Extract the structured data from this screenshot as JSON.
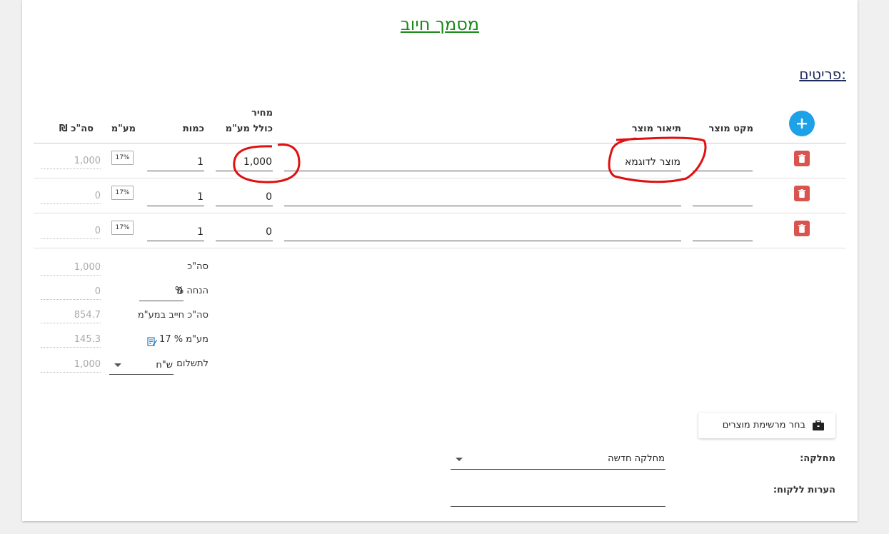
{
  "document_title": "מסמך חיוב",
  "section_title": "פריטים:",
  "columns": {
    "sku": "מקט מוצר",
    "description": "תיאור מוצר",
    "price_line1": "מחיר",
    "price_line2": "כולל מע\"מ",
    "quantity": "כמות",
    "vat": "מע\"מ",
    "total": "סה\"כ ₪"
  },
  "rows": [
    {
      "sku": "",
      "description": "מוצר לדוגמא",
      "price": "1,000",
      "quantity": "1",
      "vat": "17%",
      "total": "1,000"
    },
    {
      "sku": "",
      "description": "",
      "price": "0",
      "quantity": "1",
      "vat": "17%",
      "total": "0"
    },
    {
      "sku": "",
      "description": "",
      "price": "0",
      "quantity": "1",
      "vat": "17%",
      "total": "0"
    }
  ],
  "summary": {
    "subtotal_label": "סה\"כ",
    "subtotal_value": "1,000",
    "discount_label": "הנחה %",
    "discount_input": "0",
    "discount_value": "0",
    "taxable_label": "סה\"כ חייב במע\"מ",
    "taxable_value": "854.7",
    "vat_label": "מע\"מ % 17",
    "vat_value": "145.3",
    "payment_label": "לתשלום",
    "currency": "ש\"ח",
    "payment_value": "1,000"
  },
  "choose_products_button": "בחר מרשימת מוצרים",
  "department_label": "מחלקה:",
  "department_value": "מחלקה חדשה",
  "customer_notes_label": "הערות ללקוח:",
  "customer_notes_value": "",
  "colors": {
    "title": "#1a8a1a",
    "add_button": "#1ea1e6",
    "delete_button": "#d9534f",
    "annotation": "#e01010"
  }
}
